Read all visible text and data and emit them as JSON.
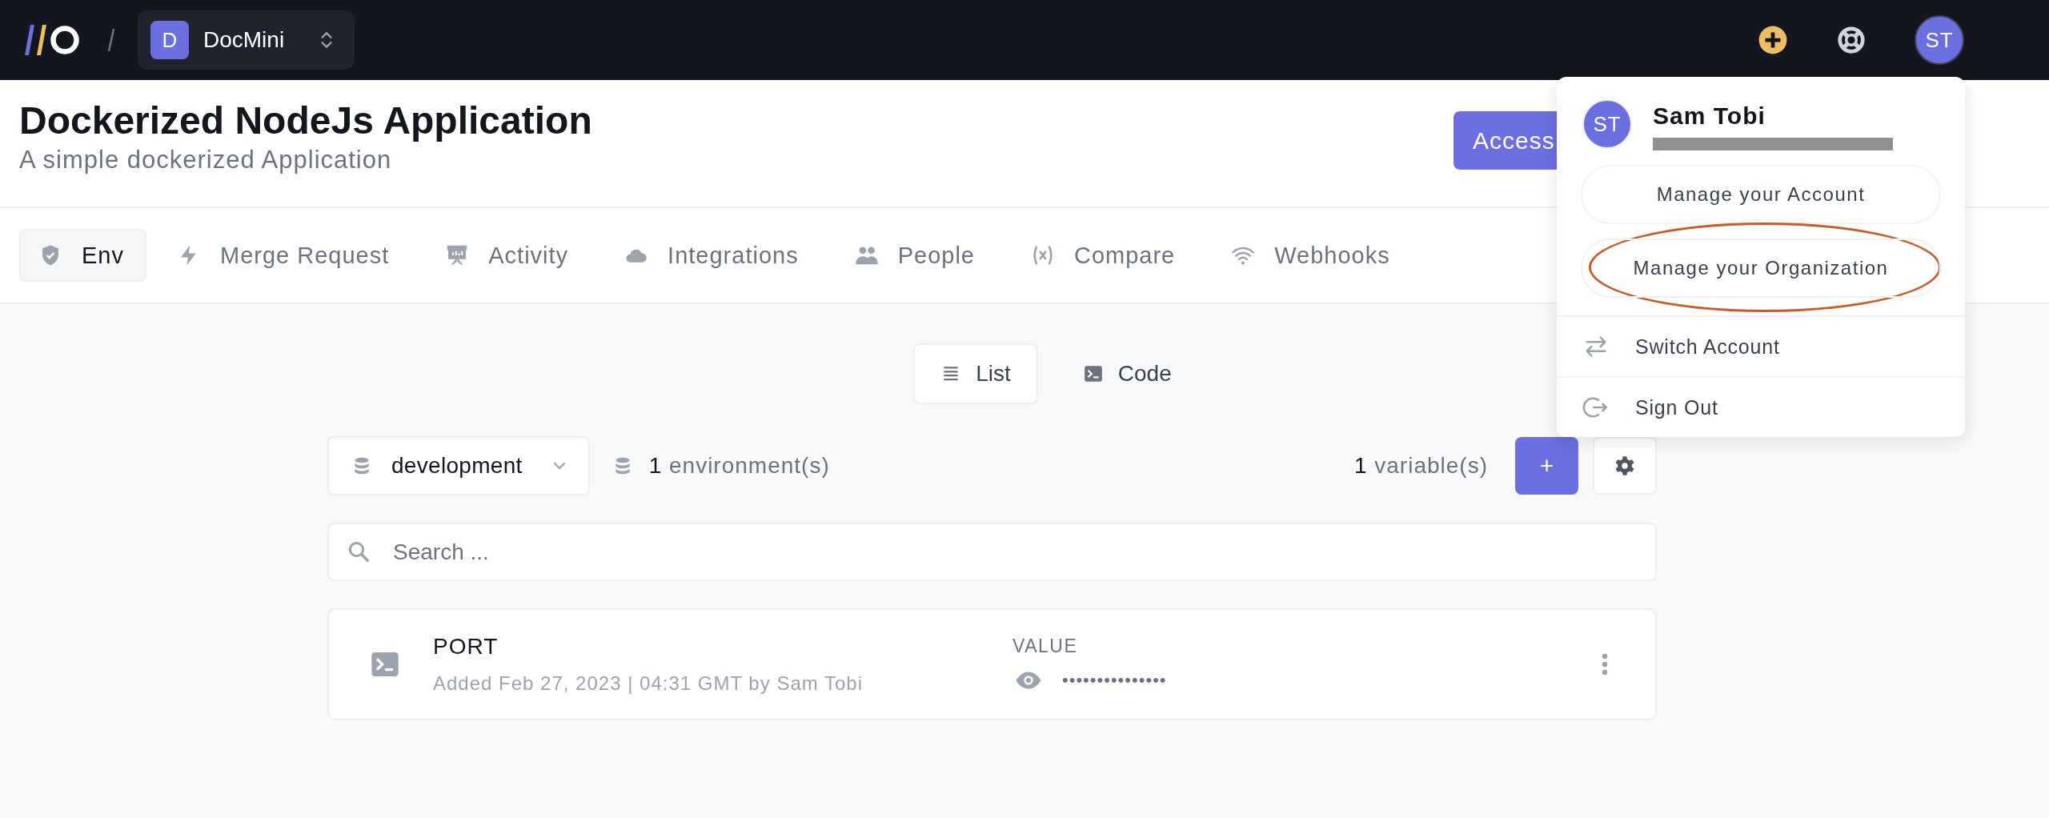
{
  "topbar": {
    "project": {
      "initial": "D",
      "name": "DocMini"
    },
    "avatar": "ST"
  },
  "header": {
    "title": "Dockerized NodeJs Application",
    "subtitle": "A simple dockerized Application",
    "primary_button": "Access"
  },
  "tabs": [
    {
      "label": "Env",
      "selected": true
    },
    {
      "label": "Merge Request",
      "selected": false
    },
    {
      "label": "Activity",
      "selected": false
    },
    {
      "label": "Integrations",
      "selected": false
    },
    {
      "label": "People",
      "selected": false
    },
    {
      "label": "Compare",
      "selected": false
    },
    {
      "label": "Webhooks",
      "selected": false
    }
  ],
  "view_toggle": [
    {
      "label": "List",
      "selected": true
    },
    {
      "label": "Code",
      "selected": false
    }
  ],
  "environment": {
    "selected": "development",
    "count": "1",
    "count_label": "environment(s)"
  },
  "variables": {
    "count": "1",
    "count_label": "variable(s)",
    "add_button": "+"
  },
  "search": {
    "placeholder": "Search ..."
  },
  "variable_rows": [
    {
      "name": "PORT",
      "meta": "Added Feb 27, 2023 | 04:31 GMT by Sam Tobi",
      "value_label": "VALUE",
      "masked_value": "•••••••••••••••"
    }
  ],
  "account_menu": {
    "avatar": "ST",
    "name": "Sam Tobi",
    "email_redacted": true,
    "buttons": [
      {
        "label": "Manage your Account",
        "highlighted": false
      },
      {
        "label": "Manage your Organization",
        "highlighted": true
      }
    ],
    "items": [
      {
        "label": "Switch Account"
      },
      {
        "label": "Sign Out"
      }
    ]
  }
}
